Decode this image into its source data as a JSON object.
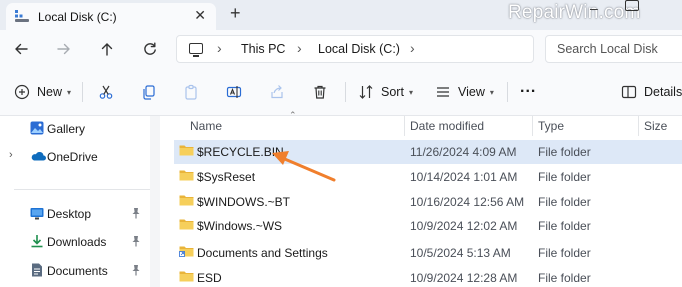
{
  "window": {
    "tab_title": "Local Disk (C:)",
    "new_tab_symbol": "+",
    "watermark": "RepairWin.com"
  },
  "address": {
    "crumbs": [
      "This PC",
      "Local Disk (C:)"
    ],
    "search_placeholder": "Search Local Disk"
  },
  "toolbar": {
    "new_label": "New",
    "sort_label": "Sort",
    "view_label": "View",
    "more_label": "...",
    "details_label": "Details"
  },
  "sidebar": {
    "items": [
      {
        "label": "Gallery",
        "icon": "gallery-icon"
      },
      {
        "label": "OneDrive",
        "icon": "onedrive-icon"
      },
      {
        "label": "Desktop",
        "icon": "desktop-icon"
      },
      {
        "label": "Downloads",
        "icon": "downloads-icon"
      },
      {
        "label": "Documents",
        "icon": "documents-icon"
      }
    ]
  },
  "columns": {
    "name": "Name",
    "date": "Date modified",
    "type": "Type",
    "size": "Size"
  },
  "files": [
    {
      "name": "$RECYCLE.BIN",
      "date": "11/26/2024 4:09 AM",
      "type": "File folder",
      "selected": true
    },
    {
      "name": "$SysReset",
      "date": "10/14/2024 1:01 AM",
      "type": "File folder"
    },
    {
      "name": "$WINDOWS.~BT",
      "date": "10/16/2024 12:56 AM",
      "type": "File folder"
    },
    {
      "name": "$Windows.~WS",
      "date": "10/9/2024 12:02 AM",
      "type": "File folder"
    },
    {
      "name": "Documents and Settings",
      "date": "10/5/2024 5:13 AM",
      "type": "File folder"
    },
    {
      "name": "ESD",
      "date": "10/9/2024 12:28 AM",
      "type": "File folder"
    }
  ],
  "colors": {
    "folder_yellow": "#f4c54a",
    "selection": "#dde8f7",
    "annotation_arrow": "#f07f2d",
    "accent_blue": "#2b6cd4"
  }
}
